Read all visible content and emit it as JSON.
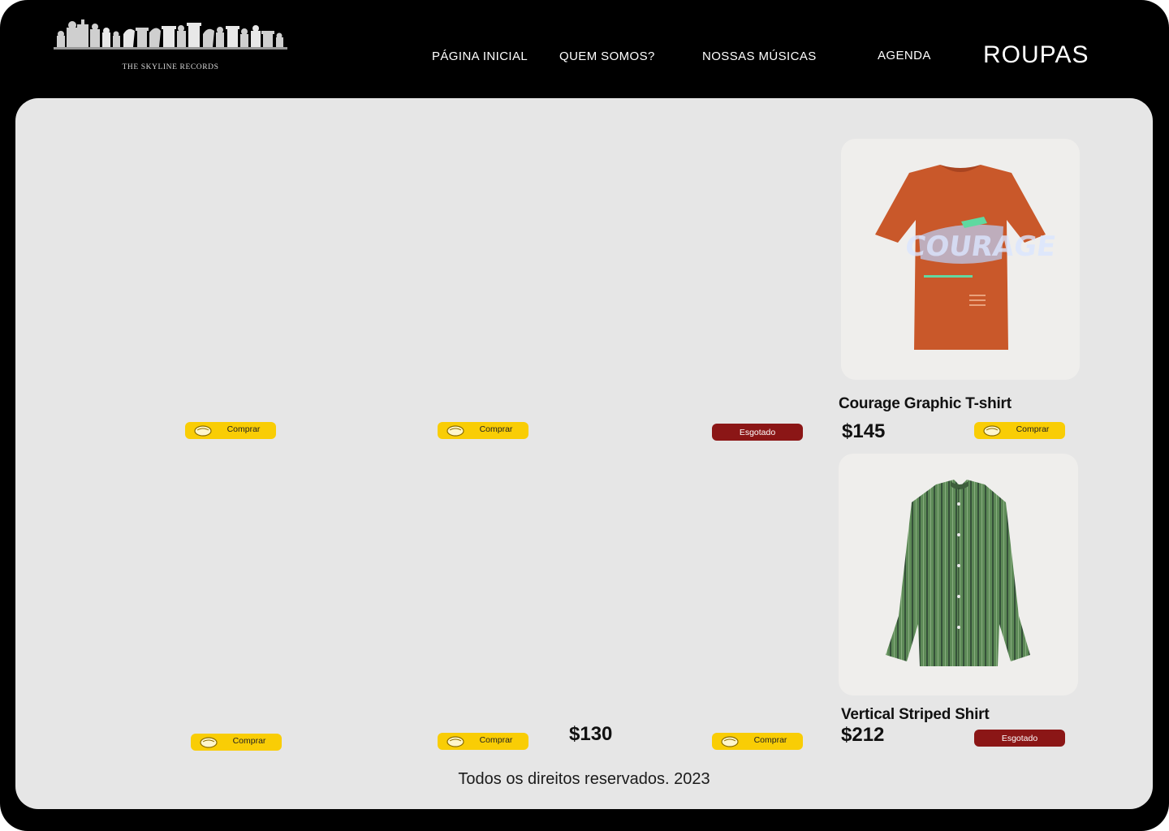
{
  "brand": {
    "logo_text": "THE SKYLINE RECORDS"
  },
  "nav": {
    "home": "PÁGINA INICIAL",
    "about": "QUEM SOMOS?",
    "music": "NOSSAS MÚSICAS",
    "schedule": "AGENDA",
    "clothes": "ROUPAS"
  },
  "buttons": {
    "buy": "Comprar",
    "sold_out": "Esgotado"
  },
  "products": {
    "tshirt": {
      "name": "Courage Graphic T-shirt",
      "price": "$145",
      "graphic_text": "COURAGE"
    },
    "shirt": {
      "name": "Vertical Striped Shirt",
      "price": "$212"
    },
    "extra_price": "$130"
  },
  "footer": {
    "text": "Todos os direitos reservados. 2023"
  },
  "colors": {
    "buy_button": "#f9cd05",
    "sold_out_button": "#8b1616",
    "panel": "#e6e6e6",
    "frame": "#000000"
  }
}
